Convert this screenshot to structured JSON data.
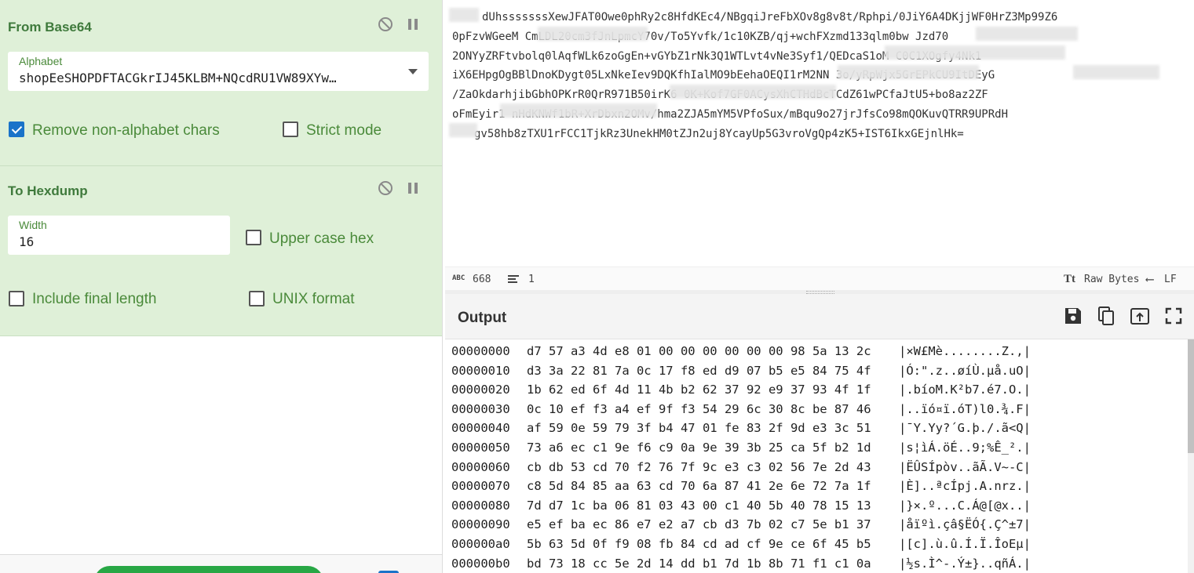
{
  "recipe": {
    "operations": [
      {
        "title": "From Base64",
        "alphabet_label": "Alphabet",
        "alphabet_value": "shopEeSHOPDFTACGkrIJ45KLBM+NQcdRU1VW89XYw…",
        "remove_non_alphabet_label": "Remove non-alphabet chars",
        "strict_mode_label": "Strict mode"
      },
      {
        "title": "To Hexdump",
        "width_label": "Width",
        "width_value": "16",
        "upper_case_hex_label": "Upper case hex",
        "include_final_length_label": "Include final length",
        "unix_format_label": "UNIX format"
      }
    ]
  },
  "input": {
    "lines": [
      "dUhsssssssXewJFAT0Owe0phRy2c8HfdKEc4/NBgqiJreFbXOv8g8v8t/Rphpi/0JiY6A4DKjjWF0HrZ3Mp99Z6",
      "0pFzvWGeeM                  CmLDL20cm3fJnLpmcY70v/To5Yvfk/1c10KZB/qj+wchFXzmd133qlm0bw                Jzd70",
      "2ONYyZRFtvbolq0lAqfWLk6zoGgEn+vGYbZ1rNk3Q1WTLvt4vNe3Syf1/QEDcaS1oM                  C0C1XOgfy4Nk1",
      "iX6EHpgOgBBlDnoKDygt05LxNkeIev9DQKfhIalMO9bEehaOEQI1rM2NN          3o/yRpWjx5GrEPkCU9ItDEyG",
      "/ZaOkdarhjibGbhOPKrR0QrR971B50irK6                 0K+Kof7GF0ACysXhCTHdBcTCdZ61wPCfaJtU5+bo8az2ZF",
      "oFmEyir1                 nHdKNWf1bR+XrDbxn2OMv/hma2ZJA5mYM5VPfoSux/mBqu9o27jrJfsCo98mQOKuvQTRR9UPRdH",
      "gv58hb8zTXU1rFCC1TjkRz3UnekHM0tZJn2uj8YcayUp5G3vroVgQp4zK5+IST6IkxGEjnlHk="
    ],
    "status_length": "668",
    "status_lines": "1",
    "status_encoding": "Raw Bytes",
    "status_eol": "LF"
  },
  "output": {
    "title": "Output",
    "hexdump": [
      {
        "offset": "00000000",
        "bytes": "d7 57 a3 4d e8 01 00 00 00 00 00 00 98 5a 13 2c",
        "ascii": "|×W£Mè........Z.,|"
      },
      {
        "offset": "00000010",
        "bytes": "d3 3a 22 81 7a 0c 17 f8 ed d9 07 b5 e5 84 75 4f",
        "ascii": "|Ó:\".z..øíÙ.µå.uO|"
      },
      {
        "offset": "00000020",
        "bytes": "1b 62 ed 6f 4d 11 4b b2 62 37 92 e9 37 93 4f 1f",
        "ascii": "|.bíoM.K²b7.é7.O.|"
      },
      {
        "offset": "00000030",
        "bytes": "0c 10 ef f3 a4 ef 9f f3 54 29 6c 30 8c be 87 46",
        "ascii": "|..ïó¤ï.óT)l0.¾.F|"
      },
      {
        "offset": "00000040",
        "bytes": "af 59 0e 59 79 3f b4 47 01 fe 83 2f 9d e3 3c 51",
        "ascii": "|¯Y.Yy?´G.þ./.ã<Q|"
      },
      {
        "offset": "00000050",
        "bytes": "73 a6 ec c1 9e f6 c9 0a 9e 39 3b 25 ca 5f b2 1d",
        "ascii": "|s¦ìÁ.öÉ..9;%Ê_².|"
      },
      {
        "offset": "00000060",
        "bytes": "cb db 53 cd 70 f2 76 7f 9c e3 c3 02 56 7e 2d 43",
        "ascii": "|ËÛSÍpòv..ãÃ.V~-C|"
      },
      {
        "offset": "00000070",
        "bytes": "c8 5d 84 85 aa 63 cd 70 6a 87 41 2e 6e 72 7a 1f",
        "ascii": "|È]..ªcÍpj.A.nrz.|"
      },
      {
        "offset": "00000080",
        "bytes": "7d d7 1c ba 06 81 03 43 00 c1 40 5b 40 78 15 13",
        "ascii": "|}×.º...C.Á@[@x..|"
      },
      {
        "offset": "00000090",
        "bytes": "e5 ef ba ec 86 e7 e2 a7 cb d3 7b 02 c7 5e b1 37",
        "ascii": "|åïºì.çâ§ËÓ{.Ç^±7|"
      },
      {
        "offset": "000000a0",
        "bytes": "5b 63 5d 0f f9 08 fb 84 cd ad cf 9e ce 6f 45 b5",
        "ascii": "|[c].ù.û.Í.Ï.ÎoEµ|"
      },
      {
        "offset": "000000b0",
        "bytes": "bd 73 18 cc 5e 2d 14 dd b1 7d 1b 8b 71 f1 c1 0a",
        "ascii": "|½s.Ì^-.Ý±}..qñÁ.|"
      }
    ]
  },
  "colors": {
    "operation_bg": "#dff0d8",
    "operation_text": "#3f7a3c",
    "checkbox_checked": "#1a73c9",
    "bake_button": "#28a745"
  },
  "icons": {
    "disable": "disable-icon",
    "pause": "pause-icon",
    "save": "save-icon",
    "copy": "copy-icon",
    "replace_input": "replace-input-icon",
    "maximise": "maximise-icon",
    "text_tools": "text-format-icon",
    "eol": "return-arrow-icon"
  }
}
